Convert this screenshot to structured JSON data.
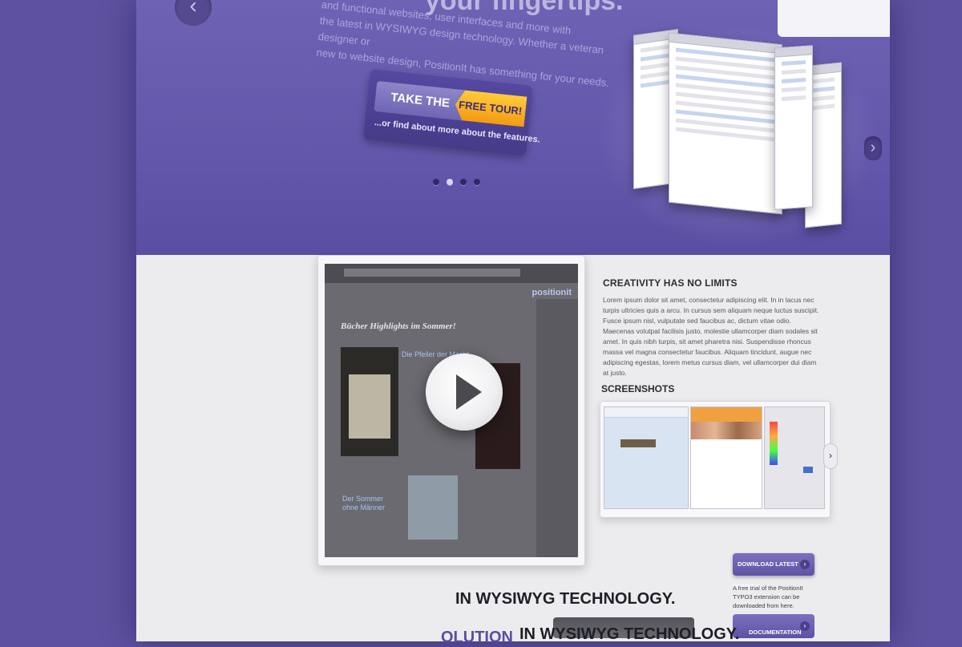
{
  "hero": {
    "heading": "your fingertips.",
    "text_lines": [
      "and functional websites, user interfaces and more with",
      "the latest in WYSIWYG design technology. Whether a veteran designer or",
      "new to website design, PositionIt has something for your needs."
    ],
    "tour_left": "TAKE THE",
    "tour_right": "FREE TOUR!",
    "tour_sub": "...or find about more about the features.",
    "slide_dots": 4,
    "active_dot": 1,
    "nav_left": "‹",
    "nav_right": "›"
  },
  "video": {
    "heading": "Bücher Highlights im Sommer!",
    "book_title_1": "Die Pfeiler der Macht",
    "book_title_2": "Der Sommer ohne Männer",
    "logo_text": "positionit"
  },
  "creativity": {
    "title": "CREATIVITY HAS NO LIMITS",
    "body": "Lorem ipsum dolor sit amet, consectetur adipiscing elit. In in lacus nec turpis ultricies quis a arcu. In cursus sem aliquam neque luctus suscipit. Fusce ipsum nisl, vulputate sed faucibus ac, dictum vitae odio. Maecenas volutpat facilisis justo, molestie ullamcorper diam sodales sit amet. In quis nibh turpis, sit amet pharetra nisi. Suspendisse rhoncus massa vel magna consectetur faucibus. Aliquam tincidunt, augue nec adipiscing egestas, lorem metus cursus diam, vel ullamcorper dui diam at justo."
  },
  "screenshots": {
    "title": "SCREENSHOTS",
    "arrow": "›"
  },
  "download": {
    "label": "DOWNLOAD LATEST VERSION",
    "text": "A free trial of the PositionIt TYPO3 extension can be downloaded from here.",
    "doc_label": "DOCUMENTATION",
    "go": "›"
  },
  "solution": {
    "line1": "IN WYSIWYG TECHNOLOGY.",
    "line2_a": "OLUTION",
    "line2_b": "IN WYSIWYG TECHNOLOGY."
  }
}
